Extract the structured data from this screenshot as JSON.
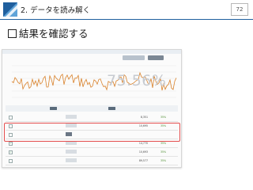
{
  "header": {
    "title": "2. データを読み解く",
    "page_number": "72"
  },
  "heading": {
    "text": "結果を確認する"
  },
  "screenshot": {
    "big_percent": "75.56%",
    "rows": [
      {
        "checked": false,
        "value": "8,351",
        "pct": "35%"
      },
      {
        "checked": false,
        "value": "10,695",
        "pct": "35%"
      },
      {
        "checked": false,
        "value": "",
        "pct": ""
      },
      {
        "checked": true,
        "value": "14,770",
        "pct": "35%"
      },
      {
        "checked": true,
        "value": "10,693",
        "pct": "35%"
      },
      {
        "checked": false,
        "value": "89,577",
        "pct": "35%"
      }
    ],
    "chart_line_color": "#d9822b"
  }
}
